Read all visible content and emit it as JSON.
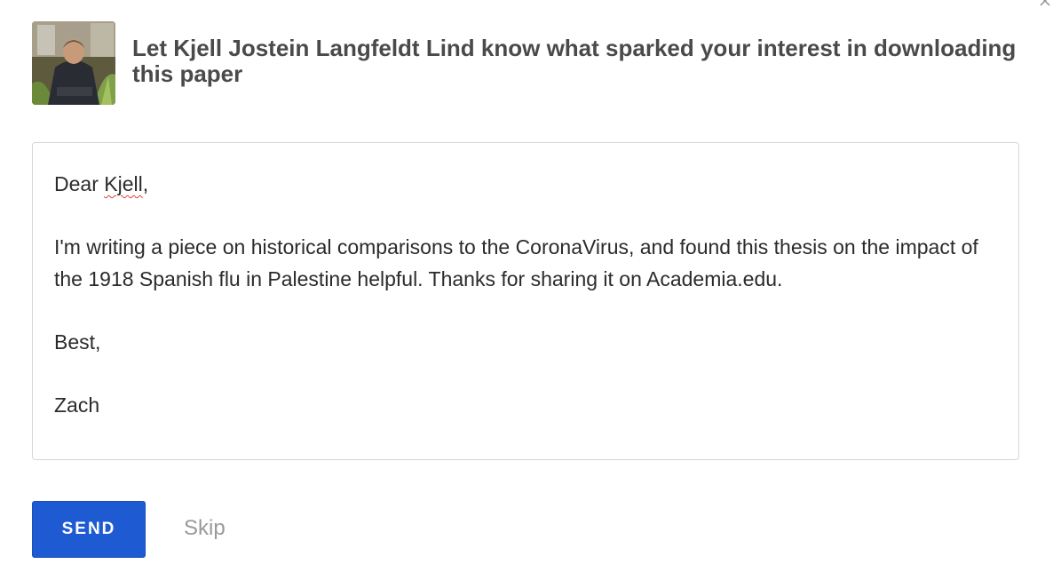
{
  "dialog": {
    "close_icon": "close-icon",
    "heading": "Let Kjell Jostein Langfeldt Lind know what sparked your interest in downloading this paper",
    "author_avatar_icon": "author-photo"
  },
  "message": {
    "greeting_prefix": "Dear ",
    "greeting_name": "Kjell",
    "greeting_suffix": ",",
    "body": "I'm writing a piece on historical comparisons to the CoronaVirus, and found this thesis on the impact of the 1918 Spanish flu in Palestine helpful. Thanks for sharing it on Academia.edu.",
    "closing": "Best,",
    "signature": "Zach"
  },
  "actions": {
    "send_label": "SEND",
    "skip_label": "Skip"
  },
  "colors": {
    "accent": "#1e5bd2",
    "heading": "#4a4a4a",
    "muted": "#9a9a9a",
    "border": "#d6d6d6"
  }
}
